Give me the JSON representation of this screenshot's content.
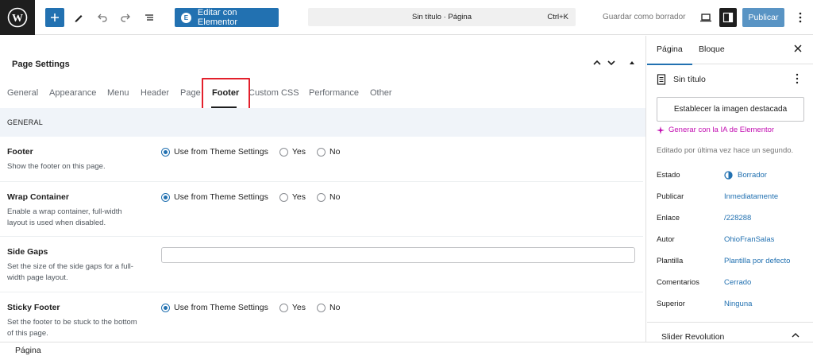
{
  "toolbar": {
    "edit_with_elementor": "Editar con Elementor",
    "doc_title": "Sin título · Página",
    "shortcut": "Ctrl+K",
    "save_draft": "Guardar como borrador",
    "publish": "Publicar"
  },
  "page_settings": {
    "title": "Page Settings",
    "tabs": [
      "General",
      "Appearance",
      "Menu",
      "Header",
      "Page",
      "Footer",
      "Custom CSS",
      "Performance",
      "Other"
    ],
    "active_tab": "Footer",
    "section": "GENERAL",
    "radio_options": [
      "Use from Theme Settings",
      "Yes",
      "No"
    ],
    "rows": [
      {
        "label": "Footer",
        "desc": "Show the footer on this page.",
        "selected": "Use from Theme Settings"
      },
      {
        "label": "Wrap Container",
        "desc": "Enable a wrap container, full-width layout is used when disabled.",
        "selected": "Use from Theme Settings"
      },
      {
        "label": "Side Gaps",
        "desc": "Set the size of the side gaps for a full-width page layout.",
        "value": ""
      },
      {
        "label": "Sticky Footer",
        "desc": "Set the footer to be stuck to the bottom of this page.",
        "selected": "Use from Theme Settings"
      }
    ]
  },
  "status_footer": {
    "breadcrumb": "Página"
  },
  "sidebar": {
    "tabs": [
      "Página",
      "Bloque"
    ],
    "doc_title": "Sin título",
    "featured_image": "Establecer la imagen destacada",
    "ai_link": "Generar con la IA de Elementor",
    "edited": "Editado por última vez hace un segundo.",
    "meta": [
      {
        "key": "Estado",
        "value": "Borrador"
      },
      {
        "key": "Publicar",
        "value": "Inmediatamente"
      },
      {
        "key": "Enlace",
        "value": "/228288"
      },
      {
        "key": "Autor",
        "value": "OhioFranSalas"
      },
      {
        "key": "Plantilla",
        "value": "Plantilla por defecto"
      },
      {
        "key": "Comentarios",
        "value": "Cerrado"
      },
      {
        "key": "Superior",
        "value": "Ninguna"
      }
    ],
    "slider_panel": "Slider Revolution"
  },
  "colors": {
    "accent": "#2271b1",
    "highlight": "#e3202c",
    "ai": "#c20eb1"
  }
}
